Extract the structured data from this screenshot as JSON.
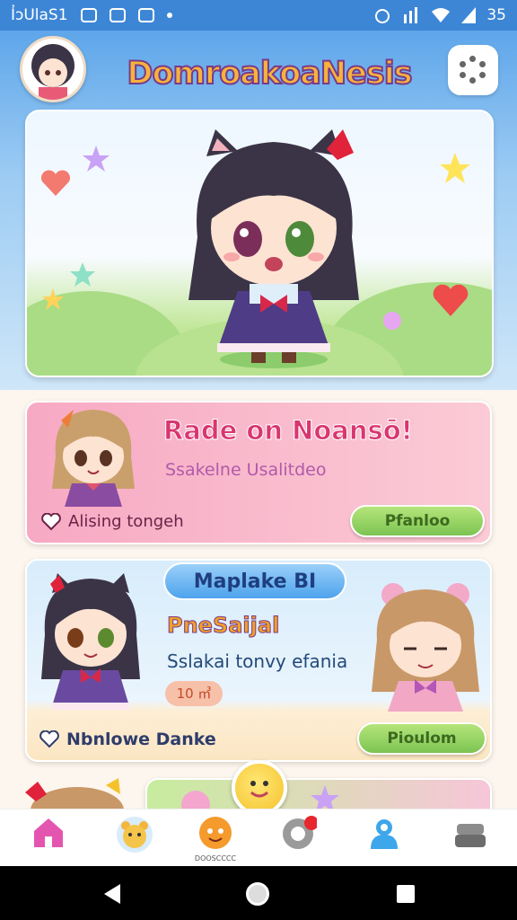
{
  "status_bar": {
    "left_text": "I҆ɔUlaS1",
    "battery": "35"
  },
  "header": {
    "app_title": "DomroakoaNesis"
  },
  "cards": [
    {
      "title": "Rade on Noansō!",
      "subtitle": "Ssakelne Usalitdeo",
      "favorite_label": "Alising tongeh",
      "button_label": "Pfanloo"
    },
    {
      "badge": "Maplake BI",
      "title": "PneSaijal",
      "subtitle": "Sslakai tonvy efania",
      "chip": "10 ㎥",
      "favorite_label": "Nbnlowe Danke",
      "button_label": "Pioulom"
    }
  ],
  "tab_bar": {
    "items": [
      {
        "icon": "home-icon"
      },
      {
        "icon": "bear-icon"
      },
      {
        "icon": "face-icon",
        "label": "DOOSCCCC"
      },
      {
        "icon": "gear-icon"
      },
      {
        "icon": "person-icon"
      },
      {
        "icon": "box-icon"
      }
    ]
  },
  "colors": {
    "status_bar": "#3d86d6",
    "card_pink": "#f7a9c3",
    "card_blue": "#d8ecfb",
    "button_green": "#7cc453"
  }
}
